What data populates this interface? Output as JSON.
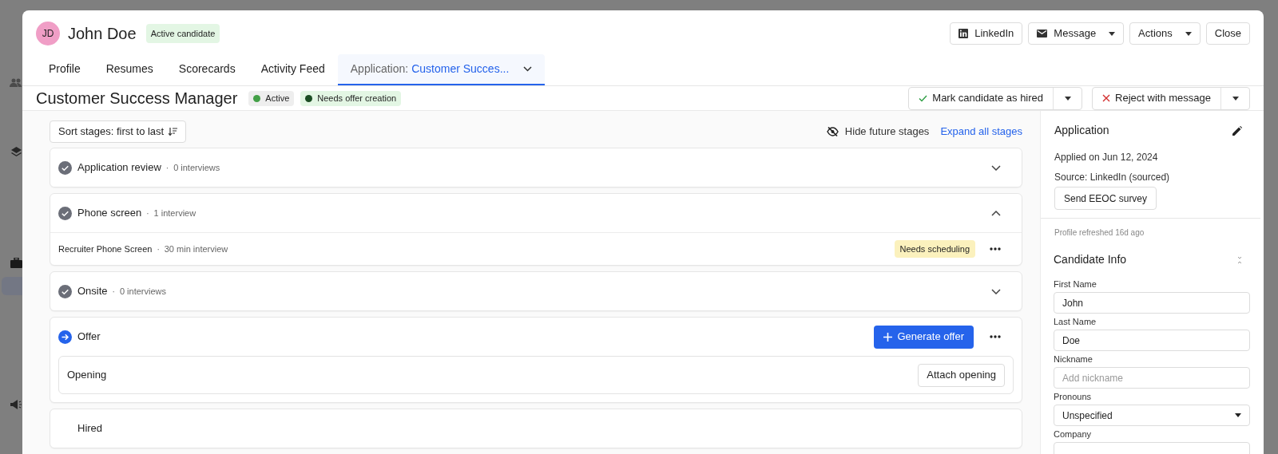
{
  "candidate": {
    "initials": "JD",
    "name": "John Doe",
    "status": "Active candidate"
  },
  "header_buttons": [
    {
      "label": "LinkedIn",
      "kind": "linkedin",
      "dropdown": false
    },
    {
      "label": "Message",
      "kind": "mail",
      "dropdown": true
    },
    {
      "label": "Actions",
      "kind": "plain",
      "dropdown": true
    },
    {
      "label": "Close",
      "kind": "plain",
      "dropdown": false
    }
  ],
  "tabs": [
    {
      "label": "Profile",
      "selected": false
    },
    {
      "label": "Resumes",
      "selected": false
    },
    {
      "label": "Scorecards",
      "selected": false
    },
    {
      "label": "Activity Feed",
      "selected": false
    },
    {
      "prefix": "Application:",
      "label": "Customer Succes...",
      "selected": true,
      "dropdown": true
    }
  ],
  "job": {
    "title": "Customer Success Manager",
    "badges": [
      {
        "label": "Active",
        "color": "#43a047",
        "kind": "gray"
      },
      {
        "label": "Needs offer creation",
        "color": "#1b4d23",
        "kind": "green"
      }
    ]
  },
  "job_actions": [
    {
      "label": "Mark candidate as hired",
      "kind": "hire"
    },
    {
      "label": "Reject with message",
      "kind": "reject"
    }
  ],
  "toolbar": {
    "sort_button": "Sort stages: first to last",
    "hide_future": "Hide future stages",
    "expand_all": "Expand all stages"
  },
  "stages": [
    {
      "kind": "completed",
      "name": "Application review",
      "separator": "·",
      "count": "0 interviews",
      "expanded": false
    },
    {
      "kind": "completed",
      "name": "Phone screen",
      "separator": "·",
      "count": "1 interview",
      "expanded": true,
      "interviews": [
        {
          "name": "Recruiter Phone Screen",
          "separator": "·",
          "duration": "30 min interview",
          "badge": "Needs scheduling"
        }
      ]
    },
    {
      "kind": "completed",
      "name": "Onsite",
      "separator": "·",
      "count": "0 interviews",
      "expanded": false
    },
    {
      "kind": "current",
      "name": "Offer",
      "action": "Generate offer",
      "opening": {
        "label": "Opening",
        "button": "Attach opening"
      }
    },
    {
      "kind": "upcoming",
      "name": "Hired"
    }
  ],
  "application": {
    "title": "Application",
    "applied": "Applied on Jun 12, 2024",
    "source": "Source: LinkedIn (sourced)",
    "survey_button": "Send EEOC survey"
  },
  "refreshed": "Profile refreshed 16d ago",
  "candidate_info": {
    "title": "Candidate Info",
    "fields": [
      {
        "label": "First Name",
        "kind": "text",
        "value": "John"
      },
      {
        "label": "Last Name",
        "kind": "text",
        "value": "Doe"
      },
      {
        "label": "Nickname",
        "kind": "text",
        "placeholder": "Add nickname"
      },
      {
        "label": "Pronouns",
        "kind": "select",
        "value": "Unspecified"
      },
      {
        "label": "Company",
        "kind": "text"
      }
    ]
  }
}
